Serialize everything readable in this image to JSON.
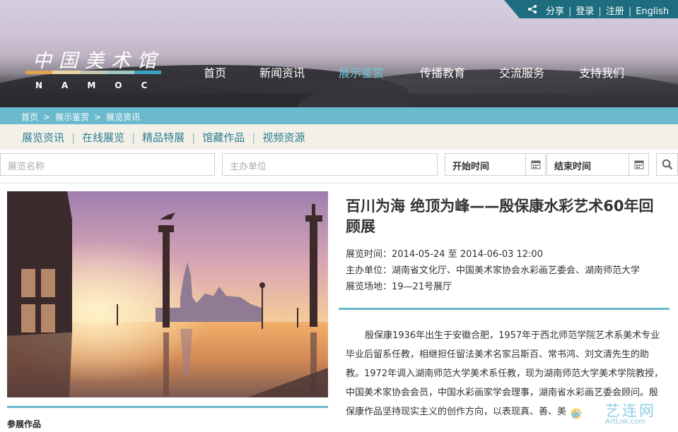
{
  "header": {
    "top_links": [
      "分享",
      "登录",
      "注册",
      "English"
    ],
    "logo_cn": "中国美术馆",
    "logo_en": "NAMOC",
    "logo_colors": [
      "#e5a24b",
      "#e7d6a6",
      "#c7c9b5",
      "#9dc8c3",
      "#3aa4c2"
    ],
    "nav": [
      {
        "label": "首页",
        "active": false
      },
      {
        "label": "新闻资讯",
        "active": false
      },
      {
        "label": "展示鉴赏",
        "active": true
      },
      {
        "label": "传播教育",
        "active": false
      },
      {
        "label": "交流服务",
        "active": false
      },
      {
        "label": "支持我们",
        "active": false
      }
    ]
  },
  "breadcrumb": [
    "首页",
    "展示鉴赏",
    "展览资讯"
  ],
  "subtabs": [
    "展览资讯",
    "在线展览",
    "精品特展",
    "馆藏作品",
    "视频资源"
  ],
  "search": {
    "name_placeholder": "展览名称",
    "organizer_placeholder": "主办单位",
    "start_label": "开始时间",
    "end_label": "结束时间"
  },
  "exhibition": {
    "title": "百川为海 绝顶为峰——殷保康水彩艺术60年回顾展",
    "time": "展览时间：2014-05-24 至 2014-06-03 12:00",
    "organizer": "主办单位：湖南省文化厅、中国美术家协会水彩画艺委会、湖南师范大学",
    "venue": "展览场地：19—21号展厅",
    "description": "殷保康1936年出生于安徽合肥，1957年于西北师范学院艺术系美术专业毕业后留系任教，相继担任留法美术名家吕斯百、常书鸿、刘文清先生的助教。1972年调入湖南师范大学美术系任教，现为湖南师范大学美术学院教授，中国美术家协会会员，中国水彩画家学会理事，湖南省水彩画艺委会顾问。殷保康作品坚持现实主义的创作方向，以表现真、善、美",
    "works_label": "参展作品"
  },
  "watermark": {
    "text": "艺连网",
    "sub": "ArtLnk.com"
  },
  "colors": {
    "accent": "#6ab9cc",
    "topbar": "#1e6d7f",
    "nav_active": "#6fc6db",
    "tab_text": "#2a7e93"
  }
}
